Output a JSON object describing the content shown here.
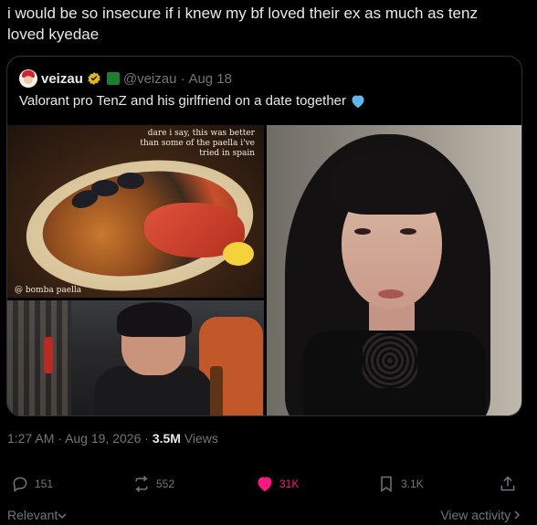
{
  "tweet": {
    "text": "i would be so insecure if i knew my bf loved their ex as much as tenz loved kyedae"
  },
  "quote": {
    "name": "veizau",
    "handle": "@veizau",
    "separator": "·",
    "date": "Aug 18",
    "text": "Valorant pro TenZ and his girlfriend on a date together",
    "images": {
      "food_caption": "dare i say, this was better than some of the paella i've tried in spain",
      "food_tag": "@ bomba paella"
    }
  },
  "meta": {
    "time": "1:27 AM",
    "separator": "·",
    "date": "Aug 19, 2026",
    "separator2": "·",
    "views_count": "3.5M",
    "views_label": "Views"
  },
  "actions": {
    "replies": "151",
    "reposts": "552",
    "likes": "31K",
    "bookmarks": "3.1K"
  },
  "footer": {
    "sort": "Relevant",
    "view_activity": "View activity"
  },
  "colors": {
    "background": "#000000",
    "text": "#e7e9ea",
    "muted": "#71767b",
    "like": "#f91880",
    "verified": "#e2b719"
  }
}
